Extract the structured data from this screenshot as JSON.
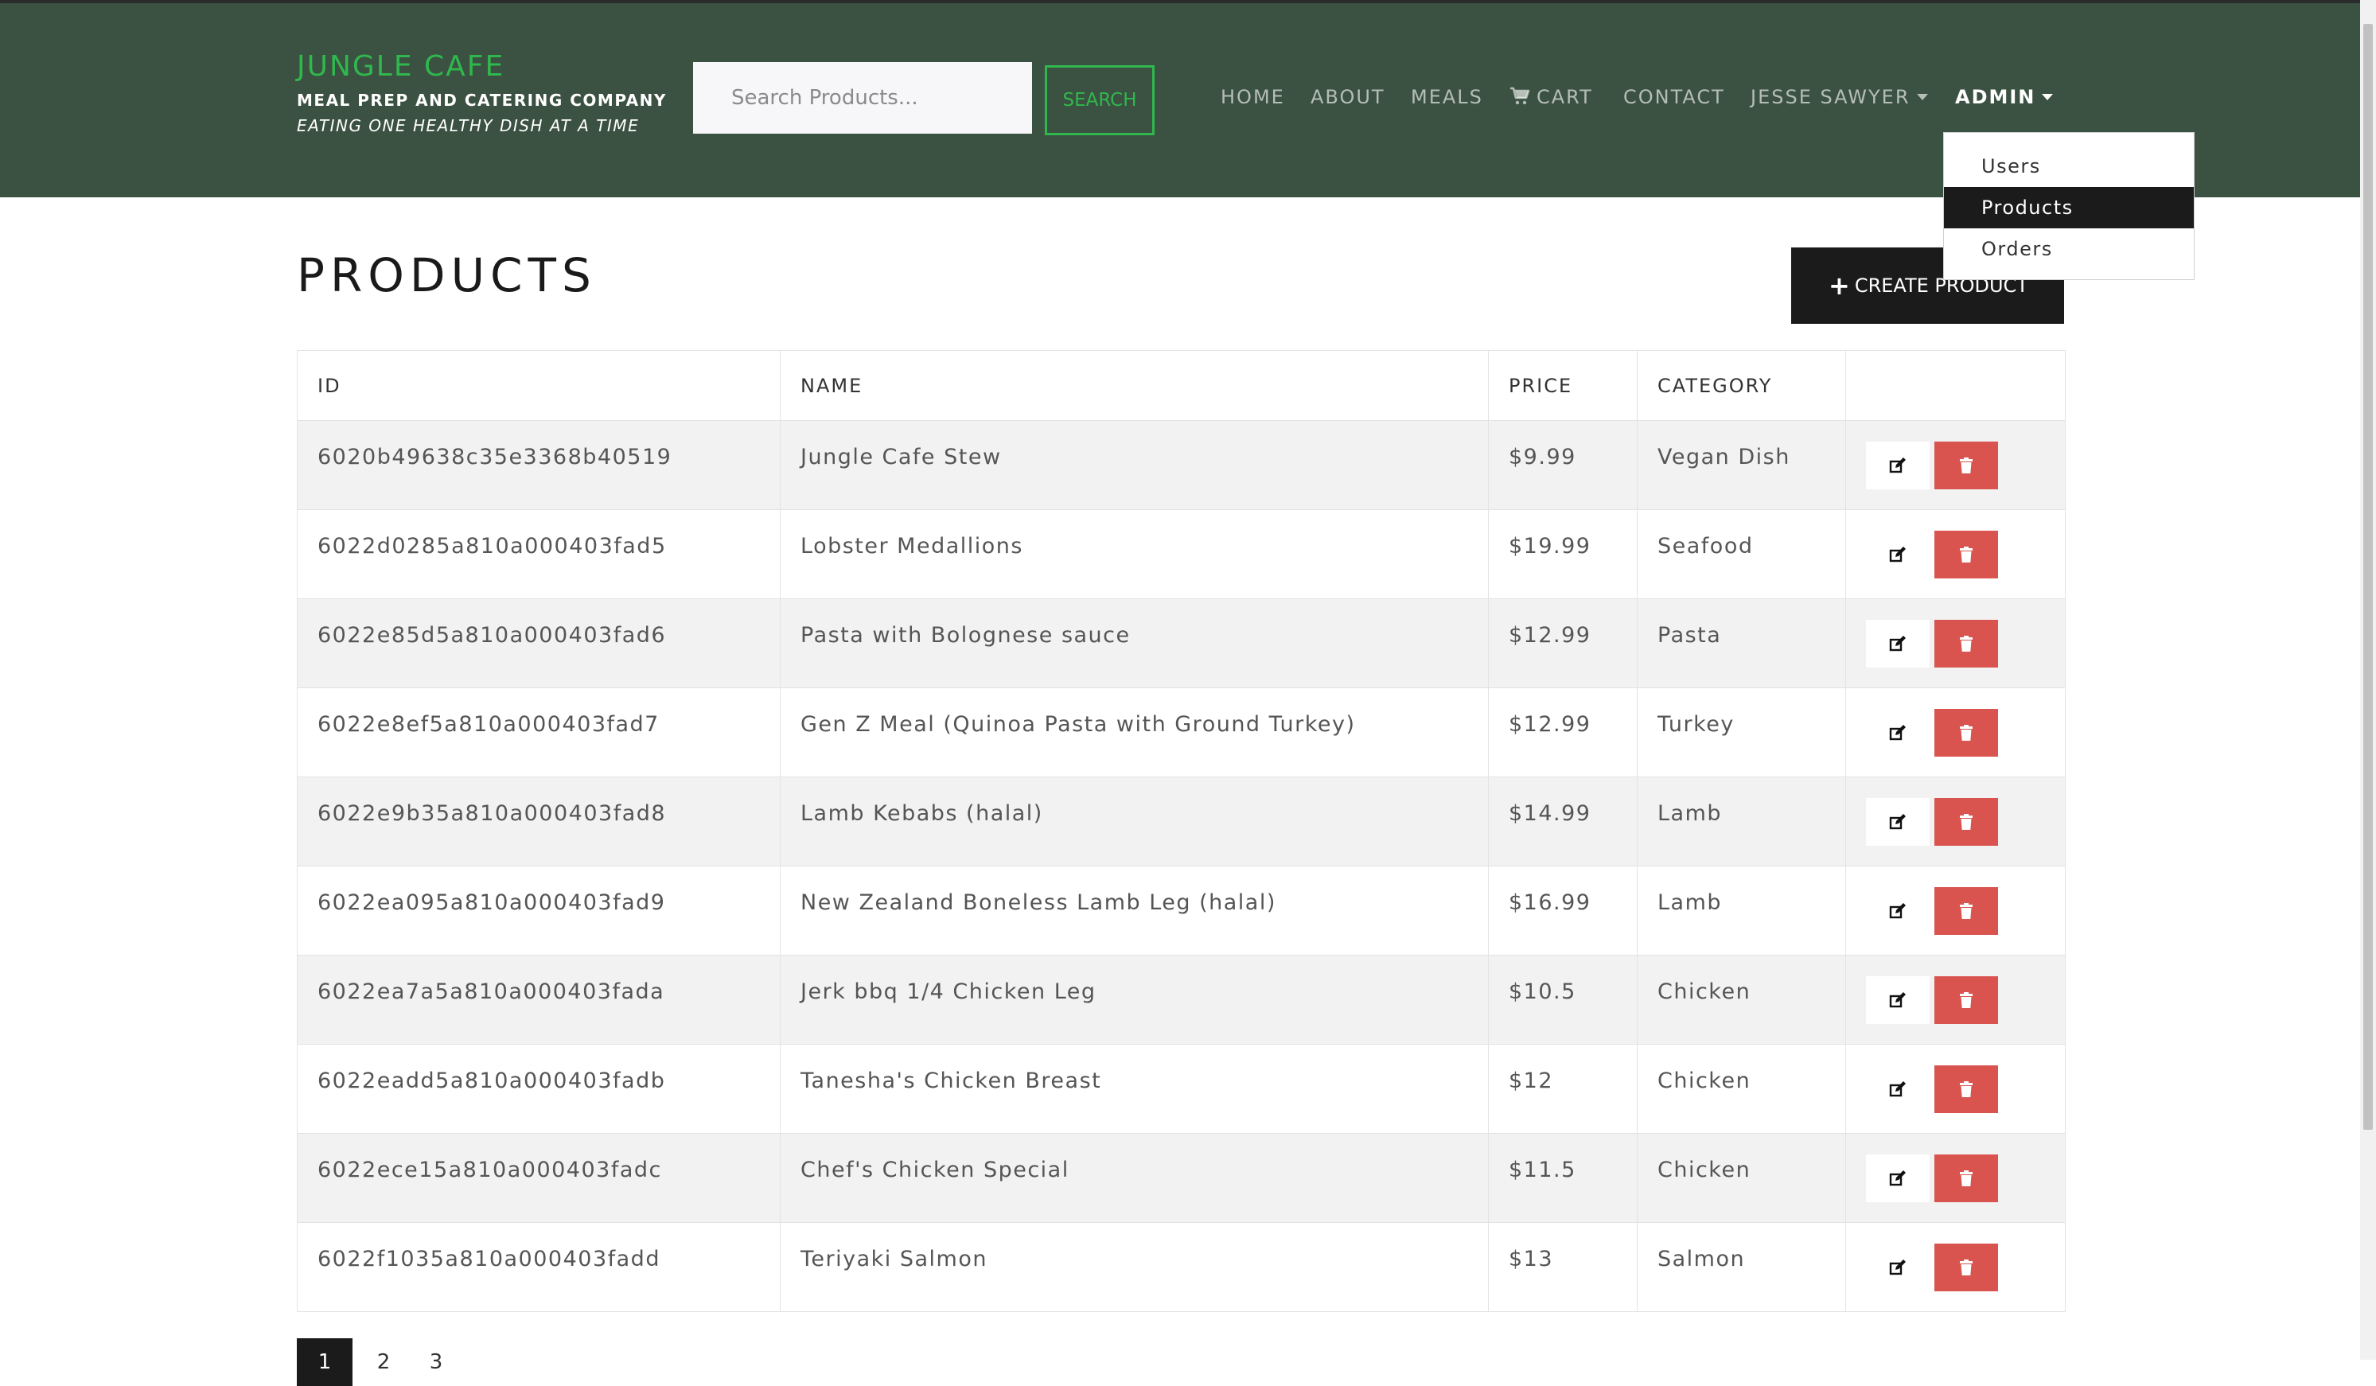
{
  "brand": {
    "name": "JUNGLE CAFE",
    "subtitle": "MEAL PREP AND CATERING COMPANY",
    "tagline": "EATING ONE HEALTHY DISH AT A TIME"
  },
  "search": {
    "placeholder": "Search Products...",
    "button": "SEARCH"
  },
  "nav": {
    "home": "HOME",
    "about": "ABOUT",
    "meals": "MEALS",
    "cart": "CART",
    "contact": "CONTACT",
    "user": "JESSE SAWYER",
    "admin": "ADMIN"
  },
  "admin_menu": [
    "Users",
    "Products",
    "Orders"
  ],
  "page": {
    "title": "PRODUCTS",
    "create_button": "CREATE PRODUCT"
  },
  "table": {
    "headers": [
      "ID",
      "NAME",
      "PRICE",
      "CATEGORY",
      ""
    ],
    "rows": [
      {
        "id": "6020b49638c35e3368b40519",
        "name": "Jungle Cafe Stew",
        "price": "$9.99",
        "category": "Vegan Dish"
      },
      {
        "id": "6022d0285a810a000403fad5",
        "name": "Lobster Medallions",
        "price": "$19.99",
        "category": "Seafood"
      },
      {
        "id": "6022e85d5a810a000403fad6",
        "name": "Pasta with Bolognese sauce",
        "price": "$12.99",
        "category": "Pasta"
      },
      {
        "id": "6022e8ef5a810a000403fad7",
        "name": "Gen Z Meal (Quinoa Pasta with Ground Turkey)",
        "price": "$12.99",
        "category": "Turkey"
      },
      {
        "id": "6022e9b35a810a000403fad8",
        "name": "Lamb Kebabs (halal)",
        "price": "$14.99",
        "category": "Lamb"
      },
      {
        "id": "6022ea095a810a000403fad9",
        "name": "New Zealand Boneless Lamb Leg (halal)",
        "price": "$16.99",
        "category": "Lamb"
      },
      {
        "id": "6022ea7a5a810a000403fada",
        "name": "Jerk bbq 1/4 Chicken Leg",
        "price": "$10.5",
        "category": "Chicken"
      },
      {
        "id": "6022eadd5a810a000403fadb",
        "name": "Tanesha's Chicken Breast",
        "price": "$12",
        "category": "Chicken"
      },
      {
        "id": "6022ece15a810a000403fadc",
        "name": "Chef's Chicken Special",
        "price": "$11.5",
        "category": "Chicken"
      },
      {
        "id": "6022f1035a810a000403fadd",
        "name": "Teriyaki Salmon",
        "price": "$13",
        "category": "Salmon"
      }
    ]
  },
  "pagination": {
    "pages": [
      "1",
      "2",
      "3"
    ],
    "current": "1"
  },
  "icons": {
    "cart": "shopping-cart-icon",
    "edit": "edit-icon",
    "delete": "trash-icon",
    "create": "plus-icon"
  },
  "colors": {
    "navbar": "#3b5141",
    "brand_accent": "#2fb84d",
    "delete": "#d9534f",
    "dark": "#1b1b1b"
  }
}
